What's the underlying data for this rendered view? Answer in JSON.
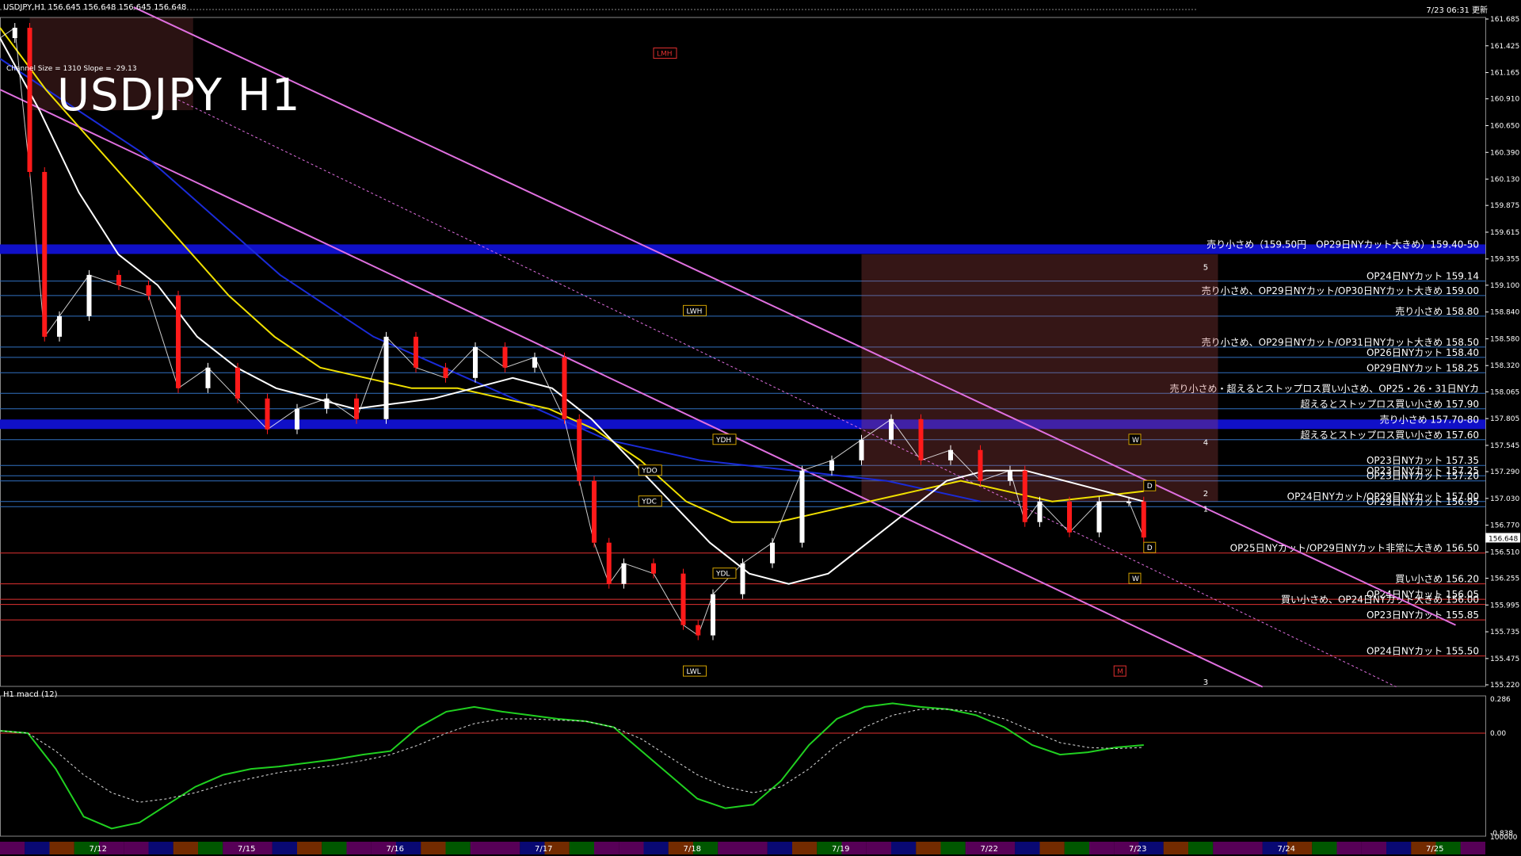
{
  "header": {
    "symbol_line": "USDJPY,H1  156.645 156.648 156.645 156.648",
    "timestamp": "7/23 06:31 更新",
    "channel_info": "Channel Size = 1310 Slope = -29.13",
    "title": "USDJPY H1",
    "macd_label": "H1  macd (12)"
  },
  "colors": {
    "background": "#000000",
    "axis": "#ffffff",
    "bull_candle": "#ffffff",
    "bear_candle": "#ff1a1a",
    "ma_white": "#ffffff",
    "ma_yellow": "#f0e000",
    "ma_blue": "#1a2bd8",
    "channel": "#e070e0",
    "bb_red": "#d01010",
    "green_line": "#20c020",
    "cloud": "#c05050",
    "blue_band": "#1010c8",
    "red_line": "#e03030",
    "level_text": "#ffffff",
    "macd_green": "#20d020",
    "macd_pink": "#f07080"
  },
  "chart_data": [
    {
      "type": "line",
      "title": "USDJPY H1",
      "price_axis_ticks": [
        "161.685",
        "161.425",
        "161.165",
        "160.910",
        "160.650",
        "160.390",
        "160.130",
        "159.875",
        "159.615",
        "159.355",
        "159.100",
        "158.840",
        "158.580",
        "158.320",
        "158.065",
        "157.805",
        "157.545",
        "157.290",
        "157.030",
        "156.770",
        "156.510",
        "156.255",
        "155.995",
        "155.735",
        "155.475",
        "155.220"
      ],
      "current_price": "156.648",
      "ylim": [
        155.22,
        161.685
      ],
      "date_labels": [
        "7/12",
        "7/15",
        "7/16",
        "7/17",
        "7/18",
        "7/19",
        "7/22",
        "7/23",
        "7/24",
        "7/25"
      ],
      "date_positions": [
        0.06,
        0.16,
        0.26,
        0.36,
        0.46,
        0.56,
        0.66,
        0.76,
        0.86,
        0.96
      ],
      "close_series": {
        "name": "",
        "x": [
          0,
          0.01,
          0.02,
          0.03,
          0.04,
          0.06,
          0.08,
          0.1,
          0.12,
          0.14,
          0.16,
          0.18,
          0.2,
          0.22,
          0.24,
          0.26,
          0.28,
          0.3,
          0.32,
          0.34,
          0.36,
          0.38,
          0.39,
          0.4,
          0.41,
          0.42,
          0.44,
          0.46,
          0.47,
          0.48,
          0.5,
          0.52,
          0.54,
          0.56,
          0.58,
          0.6,
          0.62,
          0.64,
          0.66,
          0.68,
          0.69,
          0.7,
          0.72,
          0.74,
          0.76,
          0.77
        ],
        "y": [
          161.5,
          161.6,
          160.2,
          158.6,
          158.8,
          159.2,
          159.1,
          159.0,
          158.1,
          158.3,
          158.0,
          157.7,
          157.9,
          158.0,
          157.8,
          158.6,
          158.3,
          158.2,
          158.5,
          158.3,
          158.4,
          157.8,
          157.2,
          156.6,
          156.2,
          156.4,
          156.3,
          155.8,
          155.7,
          156.1,
          156.4,
          156.6,
          157.3,
          157.4,
          157.6,
          157.8,
          157.4,
          157.5,
          157.2,
          157.3,
          156.8,
          157.0,
          156.7,
          157.0,
          157.0,
          156.65
        ]
      },
      "ma_white": [
        161.5,
        160.8,
        160.0,
        159.4,
        159.1,
        158.6,
        158.3,
        158.1,
        158.0,
        157.9,
        157.95,
        158.0,
        158.1,
        158.2,
        158.1,
        157.8,
        157.4,
        157.0,
        156.6,
        156.3,
        156.2,
        156.3,
        156.6,
        156.9,
        157.2,
        157.3,
        157.3,
        157.2,
        157.1,
        157.0
      ],
      "ma_yellow": [
        161.6,
        161.0,
        160.5,
        160.0,
        159.5,
        159.0,
        158.6,
        158.3,
        158.2,
        158.1,
        158.1,
        158.0,
        157.9,
        157.7,
        157.4,
        157.0,
        156.8,
        156.8,
        156.9,
        157.0,
        157.1,
        157.2,
        157.1,
        157.0,
        157.05,
        157.1
      ],
      "ma_blue": [
        161.3,
        161.0,
        160.7,
        160.4,
        160.0,
        159.6,
        159.2,
        158.9,
        158.6,
        158.4,
        158.2,
        158.0,
        157.8,
        157.6,
        157.5,
        157.4,
        157.35,
        157.3,
        157.25,
        157.2,
        157.1,
        157.0
      ],
      "macd": {
        "ylim": [
          -0.838,
          0.286
        ],
        "ticks": [
          "0.286",
          "0.00",
          "-0.838",
          "100000"
        ],
        "main": [
          0.02,
          0.0,
          -0.3,
          -0.7,
          -0.8,
          -0.75,
          -0.6,
          -0.45,
          -0.35,
          -0.3,
          -0.28,
          -0.25,
          -0.22,
          -0.18,
          -0.15,
          0.05,
          0.18,
          0.22,
          0.18,
          0.15,
          0.12,
          0.1,
          0.05,
          -0.15,
          -0.35,
          -0.55,
          -0.63,
          -0.6,
          -0.4,
          -0.1,
          0.12,
          0.22,
          0.25,
          0.22,
          0.2,
          0.15,
          0.05,
          -0.1,
          -0.18,
          -0.16,
          -0.12,
          -0.1
        ],
        "signal": [
          0.02,
          0.0,
          -0.15,
          -0.35,
          -0.5,
          -0.58,
          -0.55,
          -0.5,
          -0.43,
          -0.38,
          -0.33,
          -0.3,
          -0.27,
          -0.23,
          -0.18,
          -0.1,
          0.0,
          0.08,
          0.12,
          0.12,
          0.11,
          0.1,
          0.05,
          -0.05,
          -0.2,
          -0.35,
          -0.45,
          -0.5,
          -0.45,
          -0.3,
          -0.1,
          0.05,
          0.15,
          0.2,
          0.2,
          0.18,
          0.12,
          0.02,
          -0.08,
          -0.12,
          -0.13,
          -0.12
        ]
      }
    }
  ],
  "levels": [
    {
      "price": 159.45,
      "label": "売り小さめ（159.50円　OP29日NYカット大きめ）159.40-50",
      "band": true
    },
    {
      "price": 159.14,
      "label": "OP24日NYカット 159.14"
    },
    {
      "price": 159.0,
      "label": "売り小さめ、OP29日NYカット/OP30日NYカット大きめ 159.00"
    },
    {
      "price": 158.8,
      "label": "売り小さめ 158.80"
    },
    {
      "price": 158.5,
      "label": "売り小さめ、OP29日NYカット/OP31日NYカット大きめ 158.50"
    },
    {
      "price": 158.4,
      "label": "OP26日NYカット 158.40"
    },
    {
      "price": 158.25,
      "label": "OP29日NYカット 158.25"
    },
    {
      "price": 158.05,
      "label": "売り小さめ・超えるとストップロス買い小さめ、OP25・26・31日NYカ"
    },
    {
      "price": 157.9,
      "label": "超えるとストップロス買い小さめ 157.90"
    },
    {
      "price": 157.75,
      "label": "売り小さめ 157.70-80",
      "band": true
    },
    {
      "price": 157.6,
      "label": "超えるとストップロス買い小さめ 157.60"
    },
    {
      "price": 157.35,
      "label": "OP23日NYカット 157.35"
    },
    {
      "price": 157.25,
      "label": "OP23日NYカット 157.25"
    },
    {
      "price": 157.2,
      "label": "OP23日NYカット 157.20"
    },
    {
      "price": 157.0,
      "label": "OP24日NYカット/OP29日NYカット 157.00"
    },
    {
      "price": 156.95,
      "label": "OP29日NYカット 156.95"
    },
    {
      "price": 156.5,
      "label": "OP25日NYカット/OP29日NYカット非常に大きめ 156.50"
    },
    {
      "price": 156.2,
      "label": "買い小さめ 156.20"
    },
    {
      "price": 156.05,
      "label": "OP24日NYカット 156.05"
    },
    {
      "price": 156.0,
      "label": "買い小さめ、OP24日NYカット大きめ 156.00"
    },
    {
      "price": 155.85,
      "label": "OP23日NYカット 155.85"
    },
    {
      "price": 155.5,
      "label": "OP24日NYカット 155.50"
    }
  ],
  "markers": [
    {
      "text": "LWH",
      "price": 158.85,
      "x": 0.46
    },
    {
      "text": "YDH",
      "price": 157.6,
      "x": 0.48
    },
    {
      "text": "YDO",
      "price": 157.3,
      "x": 0.43
    },
    {
      "text": "YDC",
      "price": 157.0,
      "x": 0.43
    },
    {
      "text": "YDL",
      "price": 156.3,
      "x": 0.48
    },
    {
      "text": "LWL",
      "price": 155.35,
      "x": 0.46
    },
    {
      "text": "LMH",
      "price": 161.35,
      "x": 0.44
    },
    {
      "text": "W",
      "price": 157.6,
      "x": 0.76
    },
    {
      "text": "D",
      "price": 157.15,
      "x": 0.77
    },
    {
      "text": "D",
      "price": 156.55,
      "x": 0.77
    },
    {
      "text": "W",
      "price": 156.25,
      "x": 0.76
    },
    {
      "text": "M",
      "price": 155.35,
      "x": 0.75
    }
  ],
  "wave_numbers": [
    {
      "text": "5",
      "price": 159.25,
      "x": 0.81
    },
    {
      "text": "4",
      "price": 157.55,
      "x": 0.81
    },
    {
      "text": "2",
      "price": 157.05,
      "x": 0.81
    },
    {
      "text": "1",
      "price": 156.9,
      "x": 0.81
    },
    {
      "text": "3",
      "price": 155.22,
      "x": 0.81
    }
  ]
}
